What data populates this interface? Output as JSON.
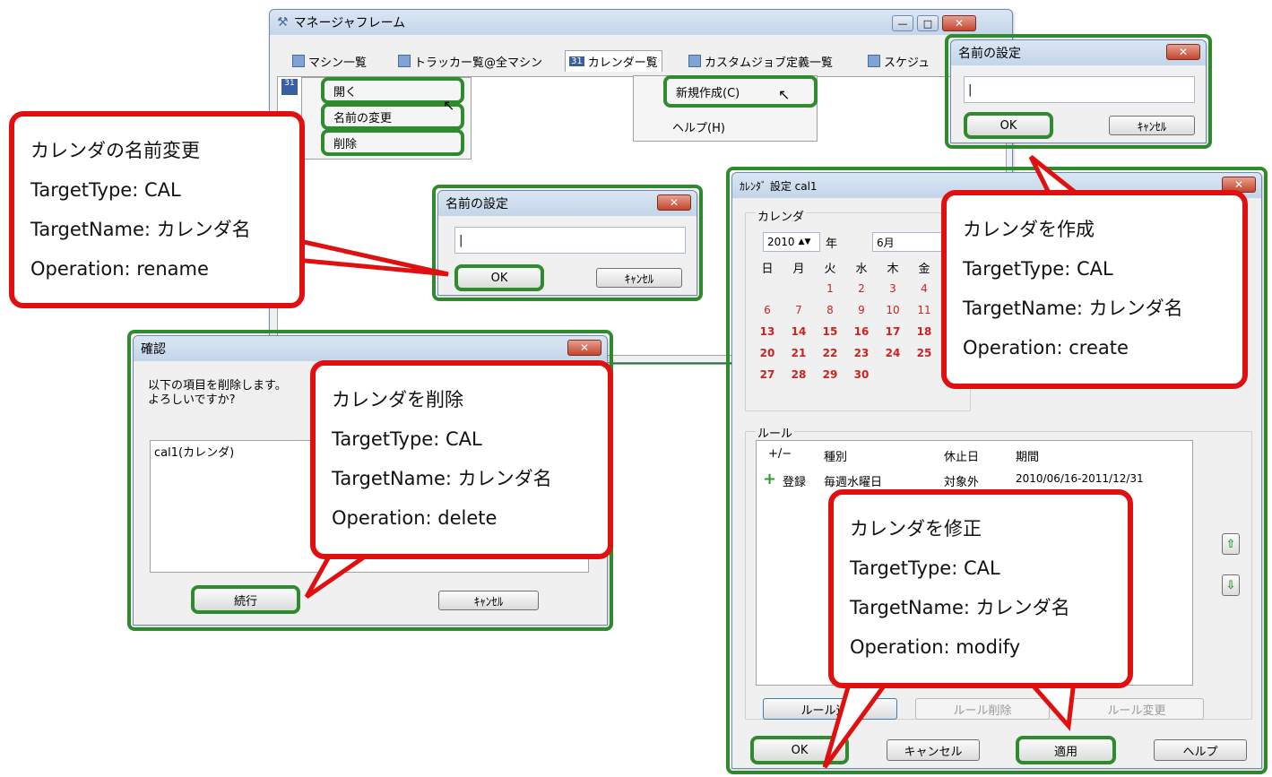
{
  "main_window": {
    "title": "マネージャフレーム",
    "tabs": [
      "マシン一覧",
      "トラッカー覧@全マシン",
      "カレンダー覧",
      "カスタムジョブ定義一覧",
      "スケジュ"
    ],
    "cal_icon_text": "31"
  },
  "context_menu": {
    "items": [
      "開く",
      "名前の変更",
      "削除"
    ]
  },
  "new_menu": {
    "items": [
      "新規作成(C)",
      "ヘルプ(H)"
    ]
  },
  "rename_dialog": {
    "title": "名前の設定",
    "input_value": "",
    "ok": "OK",
    "cancel": "ｷｬﾝｾﾙ"
  },
  "create_dialog": {
    "title": "名前の設定",
    "input_value": "",
    "ok": "OK",
    "cancel": "ｷｬﾝｾﾙ"
  },
  "confirm_dialog": {
    "title": "確認",
    "message_line1": "以下の項目を削除します。",
    "message_line2": "よろしいですか?",
    "list_item": "cal1(カレンダ)",
    "continue": "続行",
    "cancel": "ｷｬﾝｾﾙ"
  },
  "calendar_dialog": {
    "title": "ｶﾚﾝﾀﾞ 設定 cal1",
    "calendar_group": "カレンダ",
    "year_value": "2010",
    "year_label": "年",
    "month_value": "6月",
    "weekdays": [
      "日",
      "月",
      "火",
      "水",
      "木",
      "金"
    ],
    "weeks": [
      [
        "",
        "",
        "1",
        "2",
        "3",
        "4"
      ],
      [
        "6",
        "7",
        "8",
        "9",
        "10",
        "11"
      ],
      [
        "13",
        "14",
        "15",
        "16",
        "17",
        "18"
      ],
      [
        "20",
        "21",
        "22",
        "23",
        "24",
        "25"
      ],
      [
        "27",
        "28",
        "29",
        "30",
        "",
        ""
      ]
    ],
    "rule_group": "ルール",
    "rule_headers": [
      "+/−",
      "種別",
      "休止日",
      "期間"
    ],
    "rule_row": {
      "op": "登録",
      "type": "毎週水曜日",
      "holiday": "対象外",
      "period": "2010/06/16-2011/12/31"
    },
    "add_rule": "ルール追加",
    "delete_rule": "ルール削除",
    "change_rule": "ルール変更",
    "ok": "OK",
    "cancel": "キャンセル",
    "apply": "適用",
    "help": "ヘルプ"
  },
  "callouts": {
    "rename": {
      "title": "カレンダの名前変更",
      "target_type": "TargetType: CAL",
      "target_name": "TargetName: カレンダ名",
      "operation": "Operation: rename"
    },
    "create": {
      "title": "カレンダを作成",
      "target_type": "TargetType: CAL",
      "target_name": "TargetName: カレンダ名",
      "operation": "Operation: create"
    },
    "delete": {
      "title": "カレンダを削除",
      "target_type": "TargetType: CAL",
      "target_name": "TargetName: カレンダ名",
      "operation": "Operation: delete"
    },
    "modify": {
      "title": "カレンダを修正",
      "target_type": "TargetType: CAL",
      "target_name": "TargetName: カレンダ名",
      "operation": "Operation: modify"
    }
  },
  "colors": {
    "highlight_green": "#2e8b2e",
    "callout_red": "#e01010",
    "title_blue": "#c3d5ea"
  }
}
